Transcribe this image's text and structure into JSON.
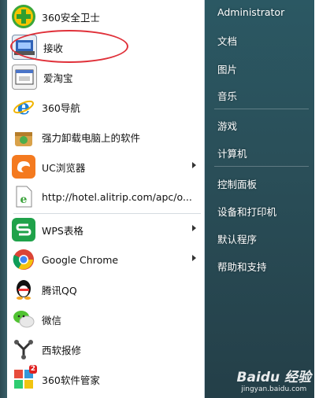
{
  "left_items": [
    {
      "label": "360安全卫士",
      "icon": "360-safe-icon"
    },
    {
      "label": "接收",
      "icon": "receive-icon"
    },
    {
      "label": "爱淘宝",
      "icon": "aitaobao-icon"
    },
    {
      "label": "360导航",
      "icon": "ie-icon"
    },
    {
      "label": "强力卸载电脑上的软件",
      "icon": "uninstall-icon"
    },
    {
      "label": "UC浏览器",
      "icon": "uc-browser-icon"
    },
    {
      "label": "http://hotel.alitrip.com/apc/o...",
      "icon": "web-link-icon"
    },
    {
      "label": "WPS表格",
      "icon": "wps-icon"
    },
    {
      "label": "Google Chrome",
      "icon": "chrome-icon"
    },
    {
      "label": "腾讯QQ",
      "icon": "qq-icon"
    },
    {
      "label": "微信",
      "icon": "wechat-icon"
    },
    {
      "label": "西软报修",
      "icon": "xiruan-icon"
    },
    {
      "label": "360软件管家",
      "icon": "360-software-icon"
    }
  ],
  "right_items": [
    "Administrator",
    "文档",
    "图片",
    "音乐",
    "游戏",
    "计算机",
    "控制面板",
    "设备和打印机",
    "默认程序",
    "帮助和支持"
  ],
  "badge": "2",
  "watermark": {
    "logo": "Baidu 经验",
    "sub": "jingyan.baidu.com"
  }
}
